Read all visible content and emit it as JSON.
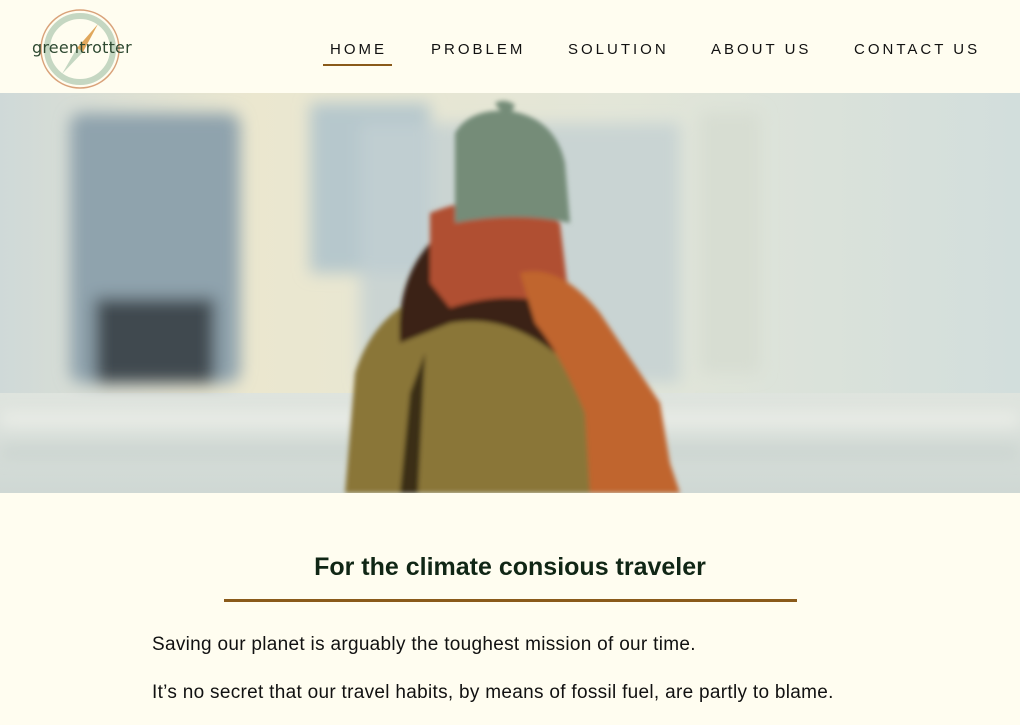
{
  "brand": {
    "logo_text": "greentrotter",
    "accent_color": "#8a5a1a",
    "background_color": "#fffdf0"
  },
  "nav": {
    "items": [
      {
        "label": "HOME",
        "active": true
      },
      {
        "label": "PROBLEM",
        "active": false
      },
      {
        "label": "SOLUTION",
        "active": false
      },
      {
        "label": "ABOUT US",
        "active": false
      },
      {
        "label": "CONTACT US",
        "active": false
      }
    ]
  },
  "main": {
    "heading": "For the climate consious traveler",
    "paragraphs": [
      "Saving our planet is arguably the toughest mission of our time.",
      "It’s no secret that our travel habits, by means of fossil fuel, are partly to blame."
    ]
  }
}
